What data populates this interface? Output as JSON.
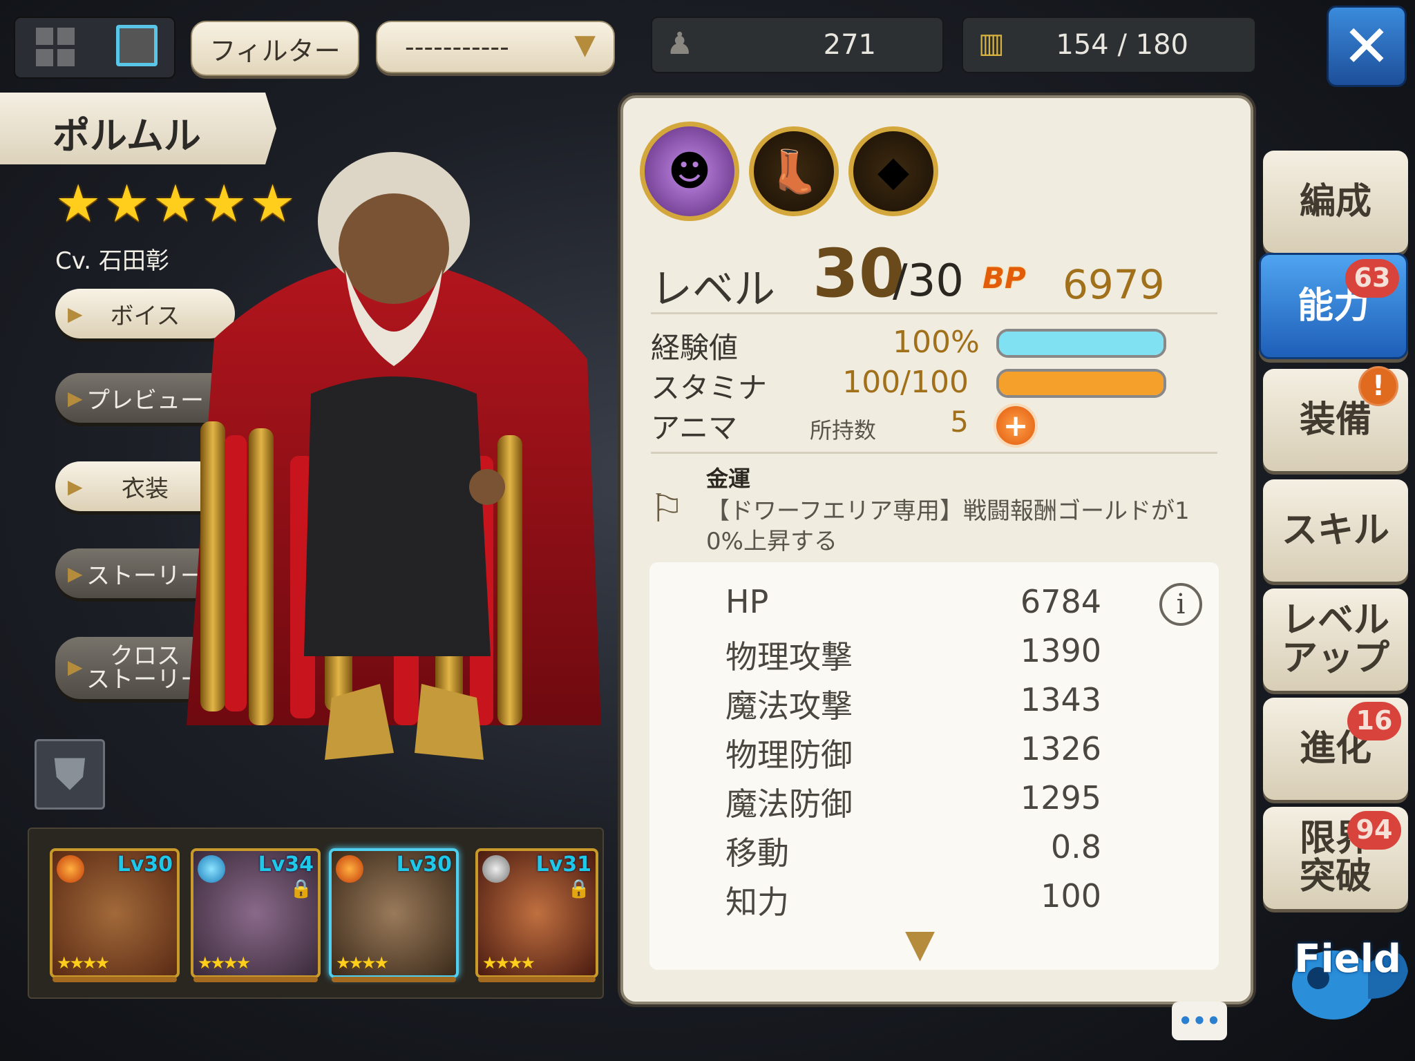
{
  "topbar": {
    "filter_label": "フィルター",
    "dropdown_value": "-----------",
    "unit_count": "271",
    "capacity": "154 / 180"
  },
  "character": {
    "name": "ポルムル",
    "stars": 5,
    "cv": "Cv. 石田彰"
  },
  "side_buttons": {
    "voice": "ボイス",
    "preview": "プレビュー",
    "costume": "衣装",
    "story": "ストーリー",
    "cross_story_1": "クロス",
    "cross_story_2": "ストーリー"
  },
  "roster": [
    {
      "level": "Lv30",
      "stars": "★★★★",
      "locked": false
    },
    {
      "level": "Lv34",
      "stars": "★★★★",
      "locked": true
    },
    {
      "level": "Lv30",
      "stars": "★★★★",
      "locked": false
    },
    {
      "level": "Lv31",
      "stars": "★★★★",
      "locked": true
    }
  ],
  "panel": {
    "level_label": "レベル",
    "level_value": "30",
    "level_max": "/30",
    "bp_label": "BP",
    "bp_value": "6979",
    "exp_label": "経験値",
    "exp_value": "100%",
    "exp_fill": 1.0,
    "stamina_label": "スタミナ",
    "stamina_value": "100/100",
    "stamina_fill": 1.0,
    "anima_label": "アニマ",
    "anima_owned_label": "所持数",
    "anima_value": "5",
    "ability_name": "金運",
    "ability_desc_1": "【ドワーフエリア専用】戦闘報酬ゴールドが1",
    "ability_desc_2": "0%上昇する",
    "stats": [
      {
        "name": "HP",
        "value": "6784"
      },
      {
        "name": "物理攻撃",
        "value": "1390"
      },
      {
        "name": "魔法攻撃",
        "value": "1343"
      },
      {
        "name": "物理防御",
        "value": "1326"
      },
      {
        "name": "魔法防御",
        "value": "1295"
      },
      {
        "name": "移動",
        "value": "0.8"
      },
      {
        "name": "知力",
        "value": "100"
      }
    ]
  },
  "tabs": {
    "formation": "編成",
    "ability": "能力",
    "ability_badge": "63",
    "equipment": "装備",
    "skill": "スキル",
    "levelup_1": "レベル",
    "levelup_2": "アップ",
    "evolution": "進化",
    "evolution_badge": "16",
    "limit_1": "限界",
    "limit_2": "突破",
    "limit_badge": "94"
  },
  "field_label": "Field",
  "colors": {
    "exp_bar": "#7fe1f2",
    "stamina_bar": "#f5a02a",
    "active_tab": "#2d7fd8",
    "gold": "#a0701b"
  }
}
